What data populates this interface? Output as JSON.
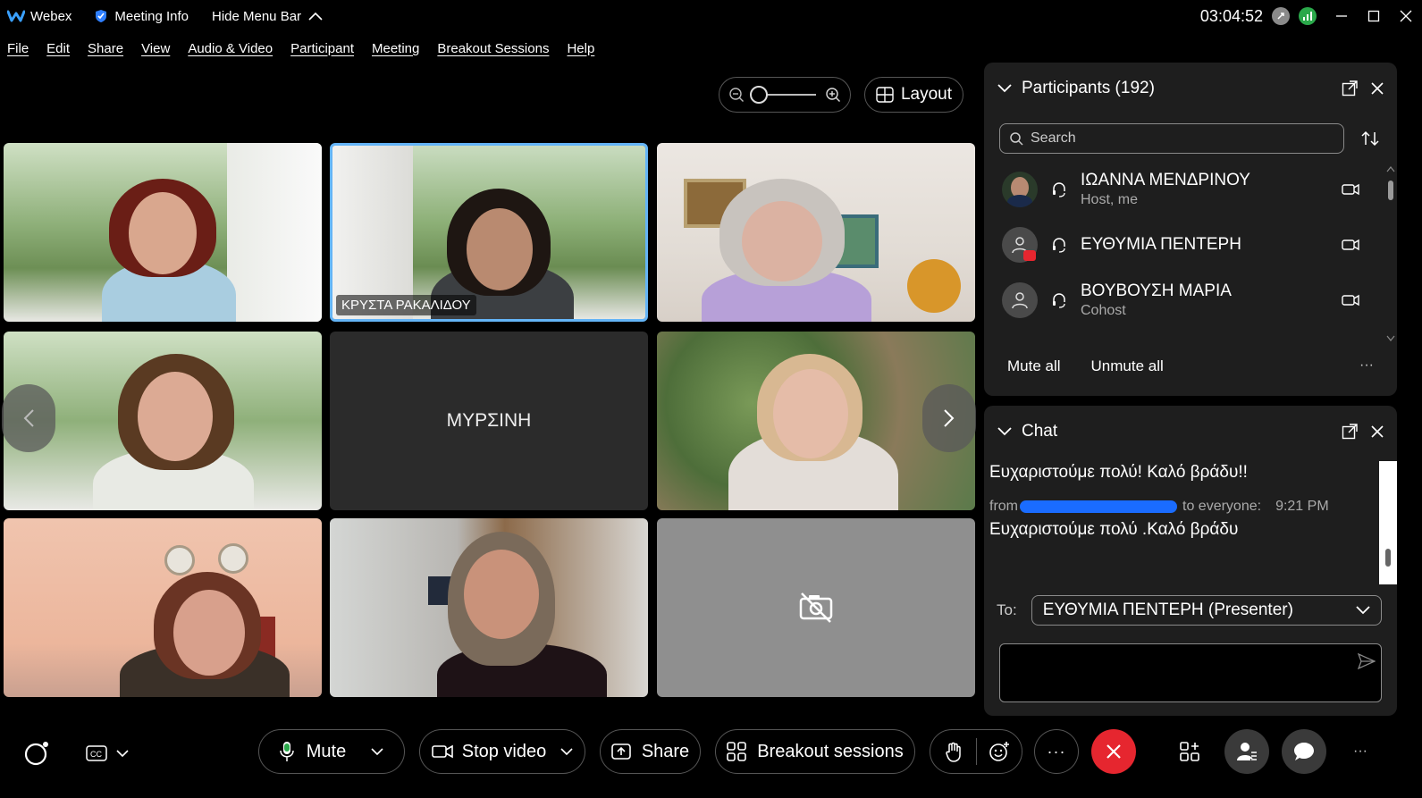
{
  "titlebar": {
    "app_name": "Webex",
    "meeting_info": "Meeting Info",
    "hide_menu": "Hide Menu Bar",
    "clock": "03:04:52"
  },
  "menu": [
    "File",
    "Edit",
    "Share",
    "View",
    "Audio & Video",
    "Participant",
    "Meeting",
    "Breakout Sessions",
    "Help"
  ],
  "view_controls": {
    "layout_label": "Layout"
  },
  "tiles": {
    "t2_name": "ΚΡΥΣΤΑ ΡΑΚΑΛΙΔΟΥ",
    "t5_name": "ΜΥΡΣΙΝΗ"
  },
  "participants": {
    "title": "Participants (192)",
    "search_placeholder": "Search",
    "list": [
      {
        "name": "ΙΩΑΝΝΑ ΜΕΝΔΡΙΝΟΥ",
        "role": "Host, me"
      },
      {
        "name": "ΕΥΘΥΜΙΑ ΠΕΝΤΕΡΗ",
        "role": ""
      },
      {
        "name": "ΒΟΥΒΟΥΣΗ ΜΑΡΙΑ",
        "role": "Cohost"
      }
    ],
    "mute_all": "Mute all",
    "unmute_all": "Unmute all",
    "more": "···"
  },
  "chat": {
    "title": "Chat",
    "msg1": "Ευχαριστούμε πολύ! Καλό βράδυ!!",
    "meta_from": "from",
    "meta_to": "to everyone:",
    "meta_time": "9:21 PM",
    "msg2": "Ευχαριστούμε πολύ .Καλό βράδυ",
    "to_label": "To:",
    "to_value": "ΕΥΘΥΜΙΑ ΠΕΝΤΕΡΗ (Presenter)"
  },
  "toolbar": {
    "mute": "Mute",
    "stop_video": "Stop video",
    "share": "Share",
    "breakout": "Breakout sessions",
    "more": "···"
  },
  "colors": {
    "accent": "#64b4f6",
    "end_call": "#e6262f",
    "panel_bg": "#1e1e1e"
  }
}
